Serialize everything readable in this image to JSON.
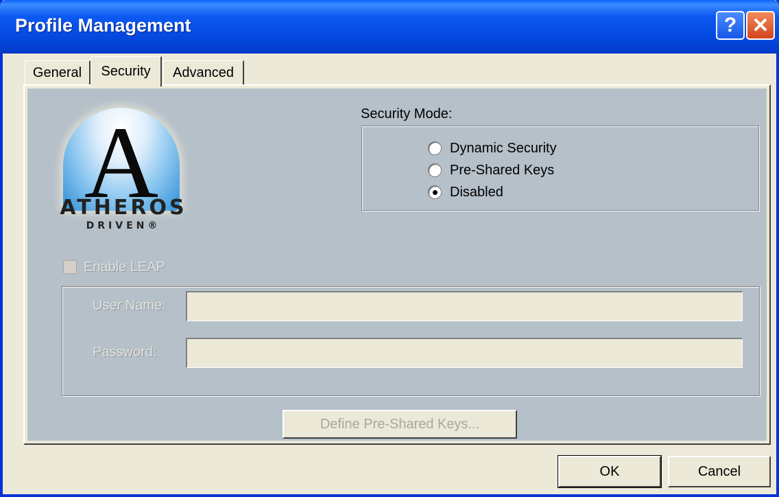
{
  "window": {
    "title": "Profile Management",
    "help_glyph": "?",
    "close_glyph": "✕"
  },
  "tabs": [
    {
      "label": "General",
      "selected": false
    },
    {
      "label": "Security",
      "selected": true
    },
    {
      "label": "Advanced",
      "selected": false
    }
  ],
  "logo": {
    "letter": "A",
    "word": "ATHEROS",
    "sub": "DRIVEN®"
  },
  "security_mode": {
    "label": "Security Mode:",
    "options": [
      {
        "label": "Dynamic Security",
        "selected": false
      },
      {
        "label": "Pre-Shared Keys",
        "selected": false
      },
      {
        "label": "Disabled",
        "selected": true
      }
    ]
  },
  "leap": {
    "label": "Enable LEAP",
    "checked": false,
    "enabled": false
  },
  "credentials": {
    "user_name_label": "User Name:",
    "user_name_value": "",
    "password_label": "Password:",
    "password_value": ""
  },
  "define_keys_button": "Define Pre-Shared Keys...",
  "buttons": {
    "ok": "OK",
    "cancel": "Cancel"
  },
  "colors": {
    "titlebar": "#0548e0",
    "panel_bg": "#b5c0c9",
    "window_bg": "#ece9d8"
  }
}
